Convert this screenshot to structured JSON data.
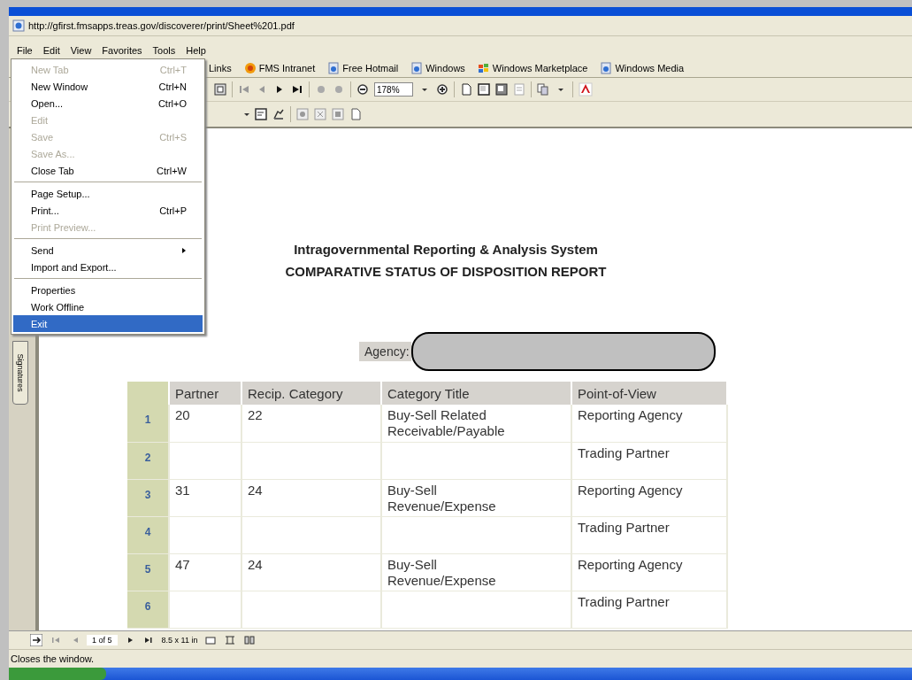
{
  "address": "http://gfirst.fmsapps.treas.gov/discoverer/print/Sheet%201.pdf",
  "menu_bar": [
    "File",
    "Edit",
    "View",
    "Favorites",
    "Tools",
    "Help"
  ],
  "links_bar": [
    {
      "label": "Links",
      "kind": "plain"
    },
    {
      "label": "FMS Intranet",
      "kind": "badge"
    },
    {
      "label": "Free Hotmail",
      "kind": "page"
    },
    {
      "label": "Windows",
      "kind": "page"
    },
    {
      "label": "Windows Marketplace",
      "kind": "flag"
    },
    {
      "label": "Windows Media",
      "kind": "page"
    }
  ],
  "toolbar": {
    "zoom": "178%"
  },
  "file_menu": [
    {
      "label": "New Tab",
      "shortcut": "Ctrl+T",
      "disabled": true,
      "selected": false
    },
    {
      "label": "New Window",
      "shortcut": "Ctrl+N",
      "disabled": false,
      "selected": false
    },
    {
      "label": "Open...",
      "shortcut": "Ctrl+O",
      "disabled": false,
      "selected": false
    },
    {
      "label": "Edit",
      "disabled": true,
      "selected": false
    },
    {
      "label": "Save",
      "shortcut": "Ctrl+S",
      "disabled": true,
      "selected": false
    },
    {
      "label": "Save As...",
      "disabled": true,
      "selected": false
    },
    {
      "label": "Close Tab",
      "shortcut": "Ctrl+W",
      "disabled": false,
      "selected": false,
      "separator_after": true
    },
    {
      "label": "Page Setup...",
      "disabled": false,
      "selected": false
    },
    {
      "label": "Print...",
      "shortcut": "Ctrl+P",
      "disabled": false,
      "selected": false
    },
    {
      "label": "Print Preview...",
      "disabled": true,
      "selected": false,
      "separator_after": true
    },
    {
      "label": "Send",
      "disabled": false,
      "selected": false,
      "submenu": true
    },
    {
      "label": "Import and Export...",
      "disabled": false,
      "selected": false,
      "separator_after": true
    },
    {
      "label": "Properties",
      "disabled": false,
      "selected": false
    },
    {
      "label": "Work Offline",
      "disabled": false,
      "selected": false
    },
    {
      "label": "Exit",
      "disabled": false,
      "selected": true
    }
  ],
  "side_tab": "Signatures",
  "report": {
    "title": "Intragovernmental Reporting & Analysis System",
    "subtitle": "COMPARATIVE STATUS OF DISPOSITION REPORT",
    "agency_label": "Agency:",
    "columns": [
      "Partner",
      "Recip. Category",
      "Category Title",
      "Point-of-View"
    ],
    "rows": [
      {
        "index": "1",
        "cells": [
          "20",
          "22",
          "Buy-Sell Related Receivable/Payable",
          "Reporting Agency"
        ]
      },
      {
        "index": "2",
        "cells": [
          "",
          "",
          "",
          "Trading Partner"
        ]
      },
      {
        "index": "3",
        "cells": [
          "31",
          "24",
          "Buy-Sell Revenue/Expense",
          "Reporting Agency"
        ]
      },
      {
        "index": "4",
        "cells": [
          "",
          "",
          "",
          "Trading Partner"
        ]
      },
      {
        "index": "5",
        "cells": [
          "47",
          "24",
          "Buy-Sell Revenue/Expense",
          "Reporting Agency"
        ]
      },
      {
        "index": "6",
        "cells": [
          "",
          "",
          "",
          "Trading Partner"
        ]
      }
    ]
  },
  "page_nav": {
    "page": "1 of 5",
    "size": "8.5 x 11 in"
  },
  "status_bar": "Closes the window."
}
